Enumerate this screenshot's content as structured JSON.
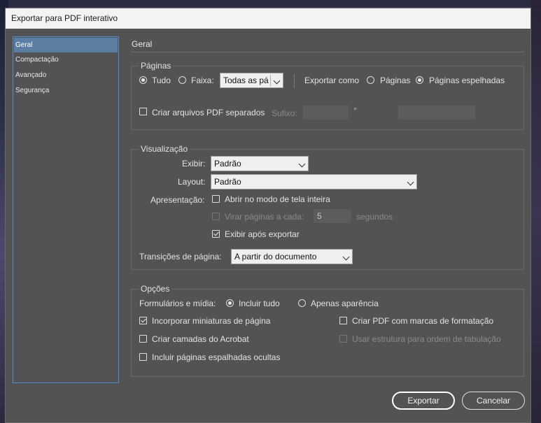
{
  "window": {
    "title": "Exportar para PDF interativo"
  },
  "sidebar": {
    "items": [
      {
        "label": "Geral",
        "selected": true
      },
      {
        "label": "Compactação"
      },
      {
        "label": "Avançado"
      },
      {
        "label": "Segurança"
      }
    ]
  },
  "section_title": "Geral",
  "paginas": {
    "title": "Páginas",
    "tudo_label": "Tudo",
    "faixa_label": "Faixa:",
    "faixa_value": "Todas as pá",
    "exportar_como_label": "Exportar como",
    "opt_paginas": "Páginas",
    "opt_espelhadas": "Páginas espelhadas",
    "separados_label": "Criar arquivos PDF separados",
    "sufixo_label": "Sufixo:"
  },
  "visualizacao": {
    "title": "Visualização",
    "exibir_label": "Exibir:",
    "exibir_value": "Padrão",
    "layout_label": "Layout:",
    "layout_value": "Padrão",
    "apresentacao_label": "Apresentação:",
    "tela_inteira_label": "Abrir no modo de tela inteira",
    "virar_label": "Virar páginas a cada:",
    "virar_value": "5",
    "segundos_label": "segundos",
    "exibir_apos_label": "Exibir após exportar",
    "transicoes_label": "Transições de página:",
    "transicoes_value": "A partir do documento"
  },
  "opcoes": {
    "title": "Opções",
    "formularios_label": "Formulários e mídia:",
    "incluir_tudo": "Incluir tudo",
    "apenas_aparencia": "Apenas aparência",
    "miniaturas": "Incorporar miniaturas de página",
    "camadas": "Criar camadas do Acrobat",
    "ocultas": "Incluir páginas espalhadas ocultas",
    "marcas": "Criar PDF com marcas de formatação",
    "estrutura": "Usar estrutura para ordem de tabulação"
  },
  "buttons": {
    "exportar": "Exportar",
    "cancelar": "Cancelar"
  }
}
